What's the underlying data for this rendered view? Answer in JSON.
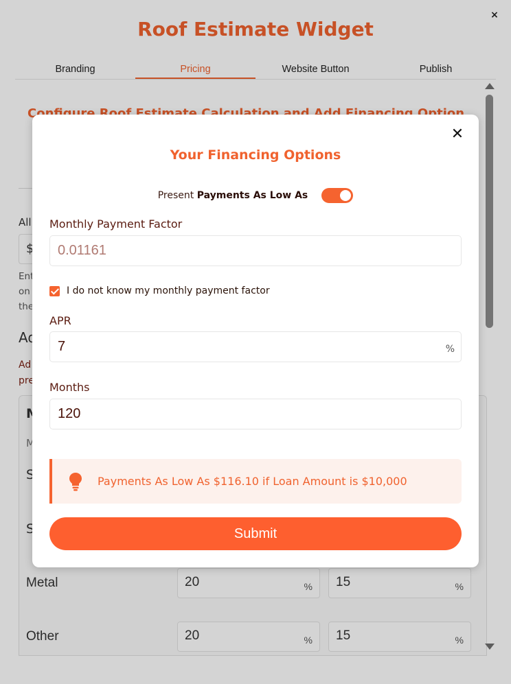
{
  "widget": {
    "title": "Roof Estimate Widget",
    "close_glyph": "×",
    "tabs": [
      {
        "label": "Branding"
      },
      {
        "label": "Pricing"
      },
      {
        "label": "Website Button"
      },
      {
        "label": "Publish"
      }
    ],
    "active_tab": "Pricing",
    "heading": "Configure Roof Estimate Calculation and Add Financing Option",
    "frag_all": "All",
    "dollar": "$",
    "frag_ent": "Ent",
    "frag_on": "on",
    "frag_the": "the",
    "frag_ad": "Ad",
    "frag_ad2": "Ad",
    "frag_pre": "pre",
    "frag_m_bold": "M",
    "frag_m": "M",
    "frag_s1": "S",
    "frag_s2": "S",
    "rows": [
      {
        "label": "Metal",
        "col1": "20",
        "col2": "15"
      },
      {
        "label": "Other",
        "col1": "20",
        "col2": "15"
      }
    ],
    "pct": "%"
  },
  "modal": {
    "close_glyph": "✕",
    "title": "Your Financing Options",
    "present_prefix": "Present",
    "present_bold": "Payments As Low As",
    "present_toggle_on": true,
    "monthly_factor_label": "Monthly Payment Factor",
    "monthly_factor_placeholder": "0.01161",
    "unknown_factor_label": "I do not know my monthly payment factor",
    "unknown_factor_checked": true,
    "apr_label": "APR",
    "apr_value": "7",
    "apr_suffix": "%",
    "months_label": "Months",
    "months_value": "120",
    "notice_text": "Payments As Low As $116.10 if Loan Amount is $10,000",
    "submit_label": "Submit"
  },
  "colors": {
    "accent": "#f0622e",
    "button": "#fe5f2f",
    "notice_bg": "#fdf1ec"
  }
}
